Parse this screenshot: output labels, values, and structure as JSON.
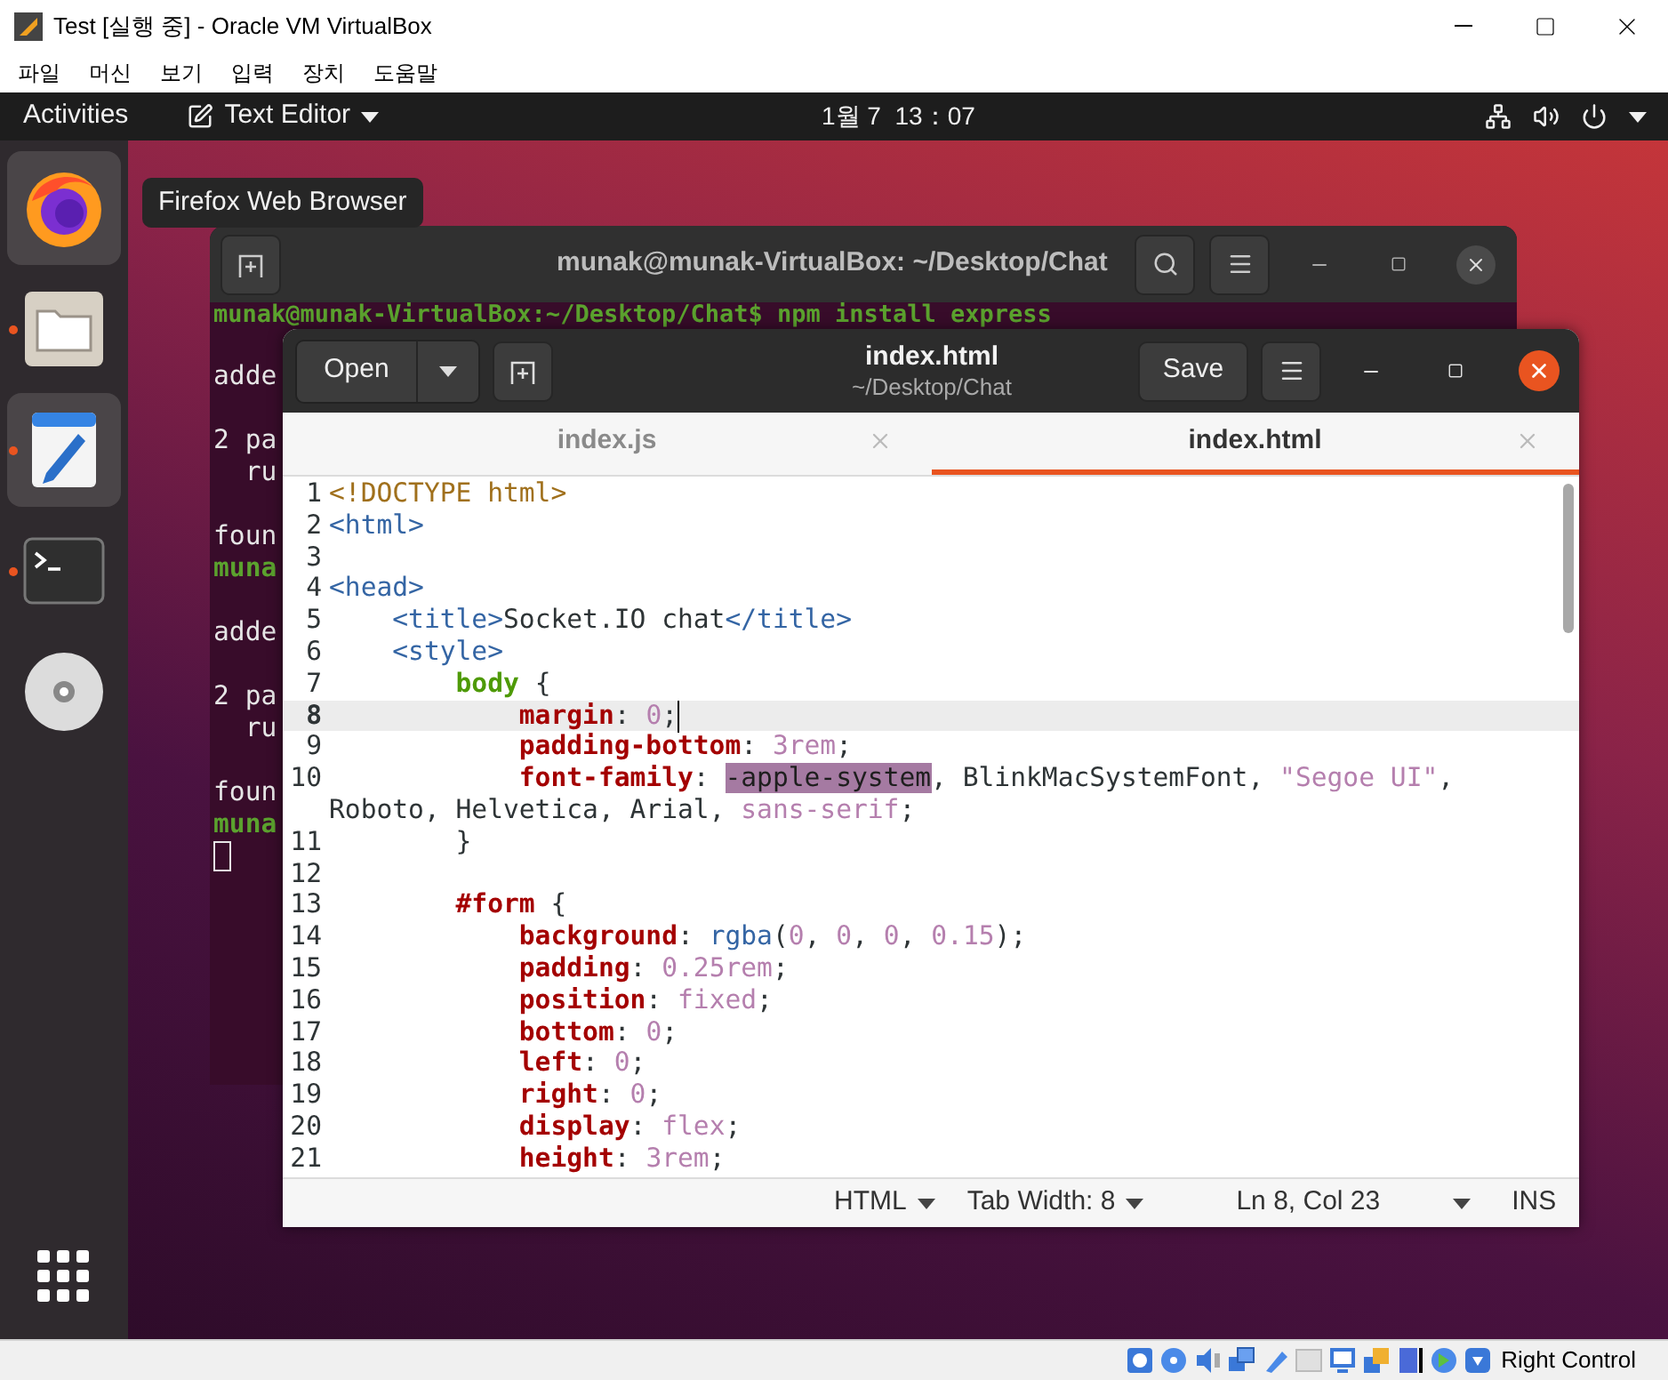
{
  "host_window": {
    "title": "Test [실행 중] - Oracle VM VirtualBox",
    "menu": [
      "파일",
      "머신",
      "보기",
      "입력",
      "장치",
      "도움말"
    ]
  },
  "top_bar": {
    "activities": "Activities",
    "app_menu": "Text Editor",
    "clock": "1월 7  13：07"
  },
  "dock": {
    "items": [
      {
        "kind": "firefox",
        "highlighted": true,
        "running": false
      },
      {
        "kind": "files",
        "highlighted": false,
        "running": true
      },
      {
        "kind": "text-editor",
        "highlighted": true,
        "running": true
      },
      {
        "kind": "terminal",
        "highlighted": false,
        "running": true
      },
      {
        "kind": "disc",
        "highlighted": false,
        "running": false
      }
    ]
  },
  "tooltip": "Firefox Web Browser",
  "terminal": {
    "title": "munak@munak-VirtualBox: ~/Desktop/Chat",
    "lines": [
      {
        "kind": "prompt",
        "text": "munak@munak-VirtualBox:~/Desktop/Chat$ npm install express"
      },
      {
        "kind": "blank"
      },
      {
        "kind": "output",
        "text": "adde"
      },
      {
        "kind": "blank"
      },
      {
        "kind": "output",
        "text": "2 pa"
      },
      {
        "kind": "output",
        "text": "  ru"
      },
      {
        "kind": "blank"
      },
      {
        "kind": "output",
        "text": "foun"
      },
      {
        "kind": "prompt",
        "text": "muna"
      },
      {
        "kind": "blank"
      },
      {
        "kind": "output",
        "text": "adde"
      },
      {
        "kind": "blank"
      },
      {
        "kind": "output",
        "text": "2 pa"
      },
      {
        "kind": "output",
        "text": "  ru"
      },
      {
        "kind": "blank"
      },
      {
        "kind": "output",
        "text": "foun"
      },
      {
        "kind": "prompt",
        "text": "muna"
      },
      {
        "kind": "cursor"
      }
    ]
  },
  "editor": {
    "open": "Open",
    "save": "Save",
    "title": "index.html",
    "path": "~/Desktop/Chat",
    "tabs": [
      {
        "label": "index.js",
        "selected": false
      },
      {
        "label": "index.html",
        "selected": true
      }
    ],
    "lines": [
      {
        "number": "1",
        "current": false,
        "segments": [
          {
            "kind": "doctype",
            "text": "<!DOCTYPE html>"
          }
        ]
      },
      {
        "number": "2",
        "current": false,
        "segments": [
          {
            "kind": "tag",
            "text": "<html>"
          }
        ]
      },
      {
        "number": "3",
        "current": false
      },
      {
        "number": "4",
        "current": false,
        "segments": [
          {
            "kind": "tag",
            "text": "<head>"
          }
        ]
      },
      {
        "number": "5",
        "current": false,
        "segments": [
          {
            "kind": "tag",
            "text": "    <title>"
          },
          {
            "kind": "text",
            "text": "Socket.IO chat"
          },
          {
            "kind": "tag",
            "text": "</title>"
          }
        ]
      },
      {
        "number": "6",
        "current": false,
        "segments": [
          {
            "kind": "tag",
            "text": "    <style>"
          }
        ]
      },
      {
        "number": "7",
        "current": false,
        "segments": [
          {
            "kind": "selector",
            "text": "        body"
          },
          {
            "kind": "text",
            "text": " {"
          }
        ]
      },
      {
        "number": "8",
        "current": true,
        "segments": [
          {
            "kind": "property",
            "text": "            margin"
          },
          {
            "kind": "text",
            "text": ": "
          },
          {
            "kind": "value",
            "text": "0"
          },
          {
            "kind": "text",
            "text": ";"
          }
        ]
      },
      {
        "number": "9",
        "current": false,
        "segments": [
          {
            "kind": "property",
            "text": "            padding-bottom"
          },
          {
            "kind": "text",
            "text": ": "
          },
          {
            "kind": "value",
            "text": "3rem"
          },
          {
            "kind": "text",
            "text": ";"
          }
        ]
      },
      {
        "number": "10",
        "current": false,
        "segments": [
          {
            "kind": "property",
            "text": "            font-family"
          },
          {
            "kind": "text",
            "text": ": "
          },
          {
            "kind": "selected",
            "text": "-apple-system"
          },
          {
            "kind": "text",
            "text": ", BlinkMacSystemFont, "
          },
          {
            "kind": "string",
            "text": "\"Segoe UI\""
          },
          {
            "kind": "text",
            "text": ","
          }
        ]
      },
      {
        "current": false,
        "segments": [
          {
            "kind": "text",
            "text": "Roboto, Helvetica, Arial, "
          },
          {
            "kind": "value",
            "text": "sans-serif"
          },
          {
            "kind": "text",
            "text": ";"
          }
        ]
      },
      {
        "number": "11",
        "current": false,
        "segments": [
          {
            "kind": "text",
            "text": "        }"
          }
        ]
      },
      {
        "number": "12",
        "current": false
      },
      {
        "number": "13",
        "current": false,
        "segments": [
          {
            "kind": "property",
            "text": "        #form"
          },
          {
            "kind": "text",
            "text": " {"
          }
        ]
      },
      {
        "number": "14",
        "current": false,
        "segments": [
          {
            "kind": "property",
            "text": "            background"
          },
          {
            "kind": "text",
            "text": ": "
          },
          {
            "kind": "func",
            "text": "rgba"
          },
          {
            "kind": "text",
            "text": "("
          },
          {
            "kind": "value",
            "text": "0"
          },
          {
            "kind": "text",
            "text": ", "
          },
          {
            "kind": "value",
            "text": "0"
          },
          {
            "kind": "text",
            "text": ", "
          },
          {
            "kind": "value",
            "text": "0"
          },
          {
            "kind": "text",
            "text": ", "
          },
          {
            "kind": "value",
            "text": "0.15"
          },
          {
            "kind": "text",
            "text": ");"
          }
        ]
      },
      {
        "number": "15",
        "current": false,
        "segments": [
          {
            "kind": "property",
            "text": "            padding"
          },
          {
            "kind": "text",
            "text": ": "
          },
          {
            "kind": "value",
            "text": "0.25rem"
          },
          {
            "kind": "text",
            "text": ";"
          }
        ]
      },
      {
        "number": "16",
        "current": false,
        "segments": [
          {
            "kind": "property",
            "text": "            position"
          },
          {
            "kind": "text",
            "text": ": "
          },
          {
            "kind": "value",
            "text": "fixed"
          },
          {
            "kind": "text",
            "text": ";"
          }
        ]
      },
      {
        "number": "17",
        "current": false,
        "segments": [
          {
            "kind": "property",
            "text": "            bottom"
          },
          {
            "kind": "text",
            "text": ": "
          },
          {
            "kind": "value",
            "text": "0"
          },
          {
            "kind": "text",
            "text": ";"
          }
        ]
      },
      {
        "number": "18",
        "current": false,
        "segments": [
          {
            "kind": "property",
            "text": "            left"
          },
          {
            "kind": "text",
            "text": ": "
          },
          {
            "kind": "value",
            "text": "0"
          },
          {
            "kind": "text",
            "text": ";"
          }
        ]
      },
      {
        "number": "19",
        "current": false,
        "segments": [
          {
            "kind": "property",
            "text": "            right"
          },
          {
            "kind": "text",
            "text": ": "
          },
          {
            "kind": "value",
            "text": "0"
          },
          {
            "kind": "text",
            "text": ";"
          }
        ]
      },
      {
        "number": "20",
        "current": false,
        "segments": [
          {
            "kind": "property",
            "text": "            display"
          },
          {
            "kind": "text",
            "text": ": "
          },
          {
            "kind": "value",
            "text": "flex"
          },
          {
            "kind": "text",
            "text": ";"
          }
        ]
      },
      {
        "number": "21",
        "current": false,
        "segments": [
          {
            "kind": "property",
            "text": "            height"
          },
          {
            "kind": "text",
            "text": ": "
          },
          {
            "kind": "value",
            "text": "3rem"
          },
          {
            "kind": "text",
            "text": ";"
          }
        ]
      }
    ],
    "status": {
      "language": "HTML",
      "tab_width": "Tab Width: 8",
      "position": "Ln 8, Col 23",
      "mode": "INS"
    }
  },
  "vbox_status": {
    "host_key": "Right Control"
  }
}
